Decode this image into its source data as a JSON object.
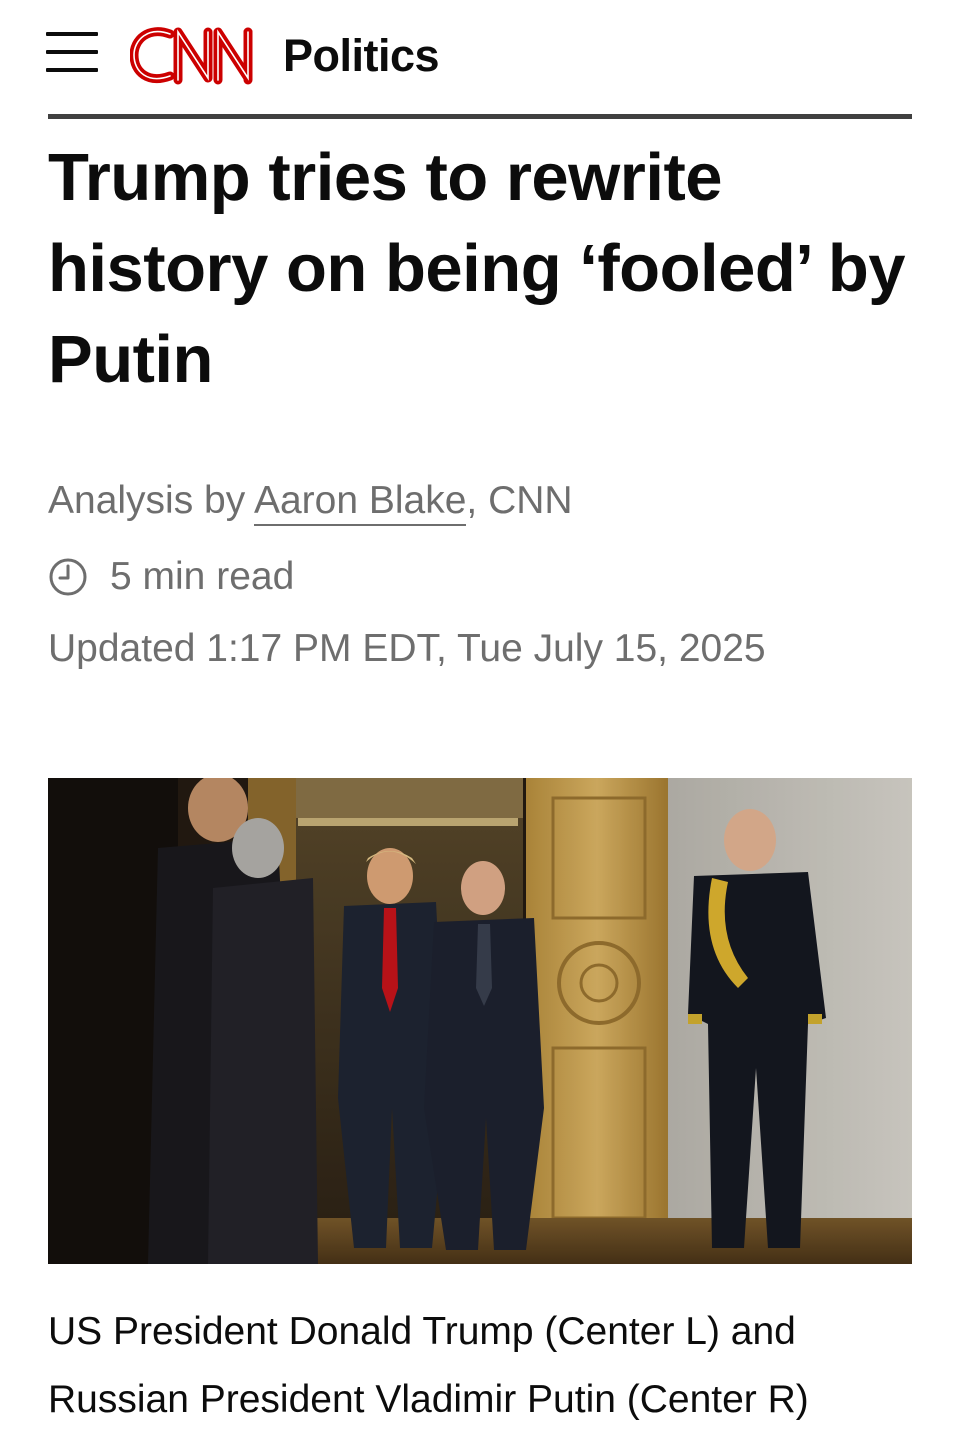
{
  "header": {
    "menu_icon": "hamburger-menu-icon",
    "logo_text": "CNN",
    "logo_color": "#cc0000",
    "section": "Politics"
  },
  "article": {
    "headline": "Trump tries to rewrite history on being ‘fooled’ by Putin",
    "byline": {
      "prefix": "Analysis by ",
      "author": "Aaron Blake",
      "suffix": ", CNN"
    },
    "read_time": {
      "icon": "clock-icon",
      "text": "5 min read"
    },
    "updated": "Updated 1:17 PM EDT, Tue July 15, 2025",
    "photo": {
      "subject": "Trump and Putin walking through a doorway"
    },
    "caption": "US President Donald Trump (Center L) and Russian President Vladimir Putin (Center R)"
  },
  "colors": {
    "text": "#0c0c0c",
    "meta": "#6e6e6e",
    "rule": "#404040",
    "brand_red": "#cc0000"
  }
}
